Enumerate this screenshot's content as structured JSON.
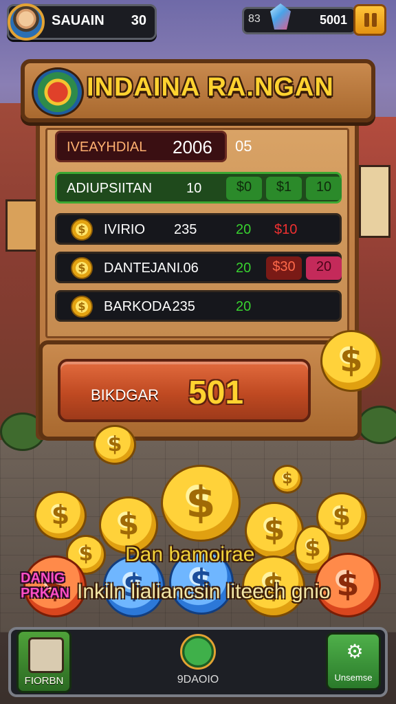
{
  "player": {
    "name": "SAUAIN",
    "level": "30"
  },
  "currency": {
    "gem_count": "83",
    "coins": "5001"
  },
  "board": {
    "title": "INDAINA RA.NGAN",
    "rows": [
      {
        "label": "IVEAYHDIAL",
        "value": "2006",
        "extra": "05"
      },
      {
        "label": "ADIUPSIITAN",
        "value": "10",
        "chips": [
          "$0",
          "$1",
          "10"
        ]
      },
      {
        "label": "IVIRIO",
        "value": "235",
        "green": "20",
        "red": "$10"
      },
      {
        "label": "DANTEJANI",
        "value": ".06",
        "green": "20",
        "chips": [
          "$30",
          "20"
        ]
      },
      {
        "label": "BARKODA",
        "value": ".235",
        "green": "20"
      }
    ],
    "coin_symbol": "$"
  },
  "action_button": {
    "label": "BIKDGAR",
    "value": "501"
  },
  "promo": {
    "line1": "Dan bamoirae",
    "badge_line1": "DANIG",
    "badge_line2": "PRKAN",
    "line2": "Inkiln lialiancsin liteech gnio"
  },
  "nav": {
    "left_label": "FIORBN",
    "center_label": "9DAOIO",
    "right_label": "Unsemse"
  },
  "colors": {
    "accent_gold": "#ffd230",
    "wood": "#b4733c",
    "positive": "#38d12f",
    "negative": "#ef3030"
  }
}
